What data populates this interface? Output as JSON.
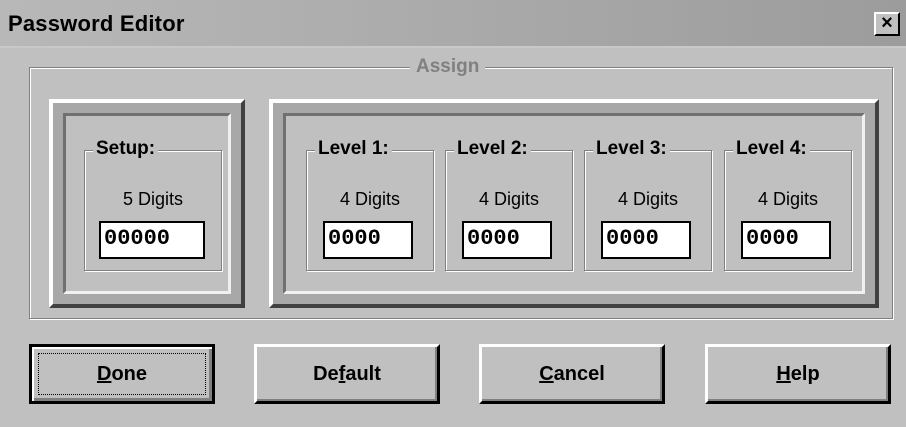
{
  "window": {
    "title": "Password Editor",
    "close_glyph": "×"
  },
  "assign": {
    "label": "Assign"
  },
  "setup": {
    "label": "Setup:",
    "digits": "5 Digits",
    "value": "00000"
  },
  "levels": [
    {
      "label": "Level 1:",
      "digits": "4 Digits",
      "value": "0000"
    },
    {
      "label": "Level 2:",
      "digits": "4 Digits",
      "value": "0000"
    },
    {
      "label": "Level 3:",
      "digits": "4 Digits",
      "value": "0000"
    },
    {
      "label": "Level 4:",
      "digits": "4 Digits",
      "value": "0000"
    }
  ],
  "buttons": {
    "done": {
      "pre": "",
      "mnemonic": "D",
      "post": "one"
    },
    "default": {
      "pre": "De",
      "mnemonic": "f",
      "post": "ault"
    },
    "cancel": {
      "pre": "",
      "mnemonic": "C",
      "post": "ancel"
    },
    "help": {
      "pre": "",
      "mnemonic": "H",
      "post": "elp"
    }
  }
}
